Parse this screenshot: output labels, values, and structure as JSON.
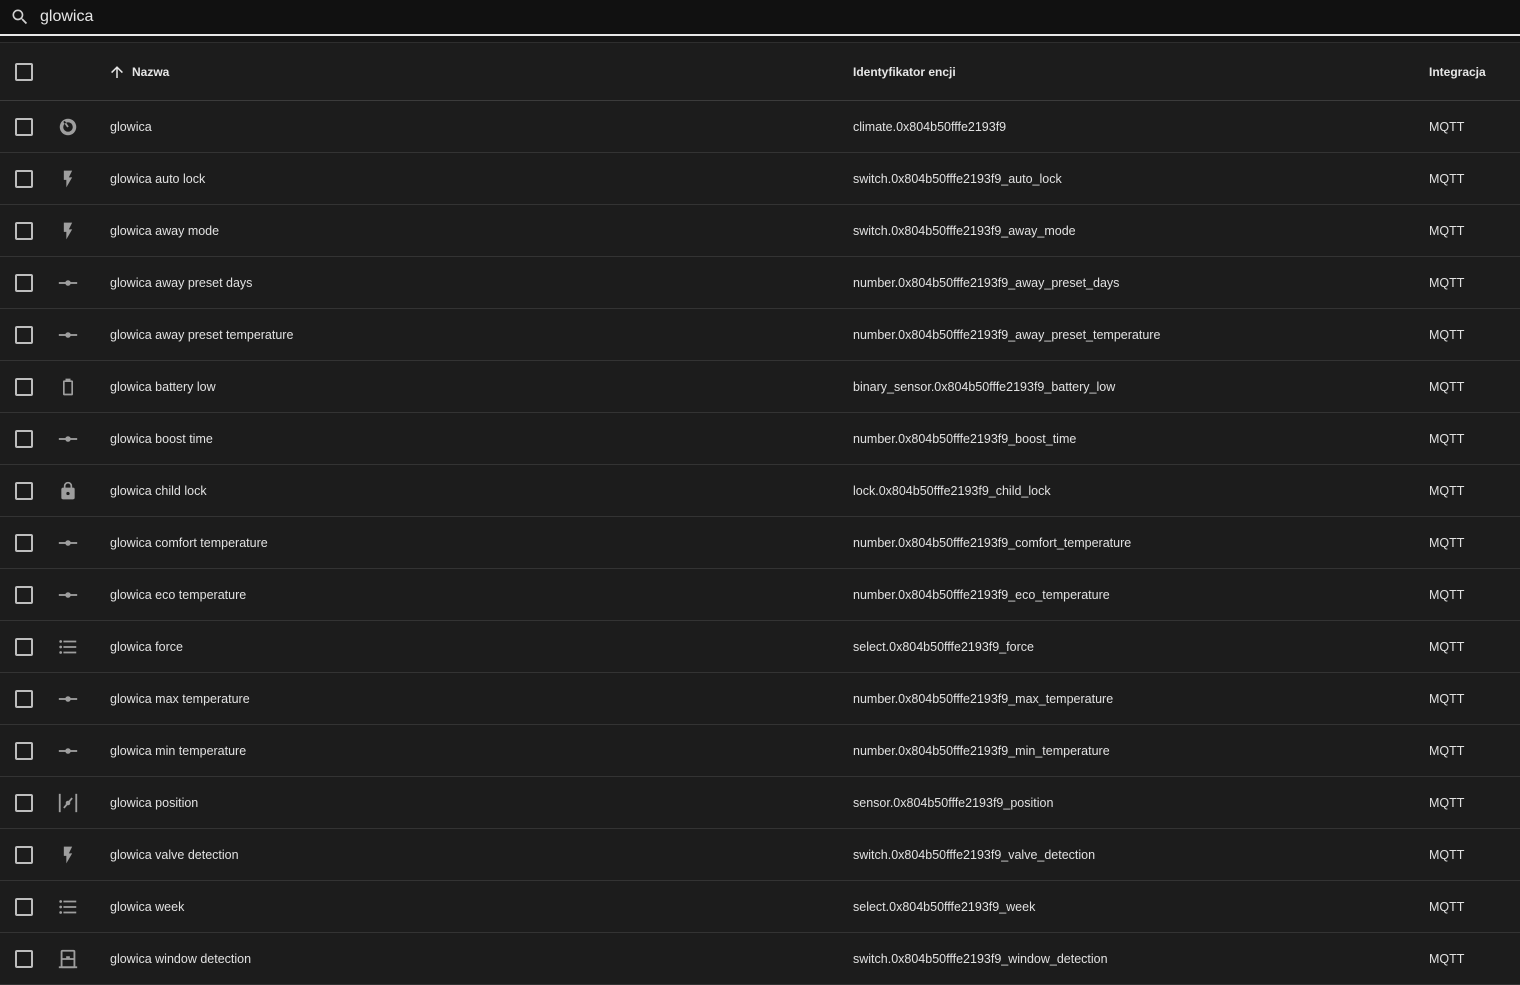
{
  "search": {
    "value": "glowica",
    "icon": "magnify-icon"
  },
  "header": {
    "name": "Nazwa",
    "entity_id": "Identyfikator encji",
    "integration": "Integracja",
    "sort_icon": "arrow-up-icon"
  },
  "rows": [
    {
      "icon": "thermostat-icon",
      "name": "glowica",
      "entity_id": "climate.0x804b50fffe2193f9",
      "integration": "MQTT"
    },
    {
      "icon": "flash-icon",
      "name": "glowica auto lock",
      "entity_id": "switch.0x804b50fffe2193f9_auto_lock",
      "integration": "MQTT"
    },
    {
      "icon": "flash-icon",
      "name": "glowica away mode",
      "entity_id": "switch.0x804b50fffe2193f9_away_mode",
      "integration": "MQTT"
    },
    {
      "icon": "ray-vertex-icon",
      "name": "glowica away preset days",
      "entity_id": "number.0x804b50fffe2193f9_away_preset_days",
      "integration": "MQTT"
    },
    {
      "icon": "ray-vertex-icon",
      "name": "glowica away preset temperature",
      "entity_id": "number.0x804b50fffe2193f9_away_preset_temperature",
      "integration": "MQTT"
    },
    {
      "icon": "battery-outline-icon",
      "name": "glowica battery low",
      "entity_id": "binary_sensor.0x804b50fffe2193f9_battery_low",
      "integration": "MQTT"
    },
    {
      "icon": "ray-vertex-icon",
      "name": "glowica boost time",
      "entity_id": "number.0x804b50fffe2193f9_boost_time",
      "integration": "MQTT"
    },
    {
      "icon": "lock-icon",
      "name": "glowica child lock",
      "entity_id": "lock.0x804b50fffe2193f9_child_lock",
      "integration": "MQTT"
    },
    {
      "icon": "ray-vertex-icon",
      "name": "glowica comfort temperature",
      "entity_id": "number.0x804b50fffe2193f9_comfort_temperature",
      "integration": "MQTT"
    },
    {
      "icon": "ray-vertex-icon",
      "name": "glowica eco temperature",
      "entity_id": "number.0x804b50fffe2193f9_eco_temperature",
      "integration": "MQTT"
    },
    {
      "icon": "format-list-bulleted-icon",
      "name": "glowica force",
      "entity_id": "select.0x804b50fffe2193f9_force",
      "integration": "MQTT"
    },
    {
      "icon": "ray-vertex-icon",
      "name": "glowica max temperature",
      "entity_id": "number.0x804b50fffe2193f9_max_temperature",
      "integration": "MQTT"
    },
    {
      "icon": "ray-vertex-icon",
      "name": "glowica min temperature",
      "entity_id": "number.0x804b50fffe2193f9_min_temperature",
      "integration": "MQTT"
    },
    {
      "icon": "valve-icon",
      "name": "glowica position",
      "entity_id": "sensor.0x804b50fffe2193f9_position",
      "integration": "MQTT"
    },
    {
      "icon": "flash-icon",
      "name": "glowica valve detection",
      "entity_id": "switch.0x804b50fffe2193f9_valve_detection",
      "integration": "MQTT"
    },
    {
      "icon": "format-list-bulleted-icon",
      "name": "glowica week",
      "entity_id": "select.0x804b50fffe2193f9_week",
      "integration": "MQTT"
    },
    {
      "icon": "window-closed-icon",
      "name": "glowica window detection",
      "entity_id": "switch.0x804b50fffe2193f9_window_detection",
      "integration": "MQTT"
    }
  ]
}
